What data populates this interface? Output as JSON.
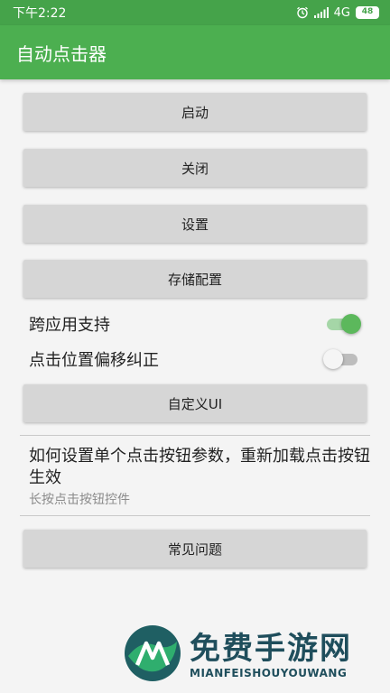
{
  "status_bar": {
    "time": "下午2:22",
    "network": "4G",
    "battery": "48",
    "icons": [
      "alarm-icon",
      "signal-icon"
    ]
  },
  "app_bar": {
    "title": "自动点击器"
  },
  "buttons": {
    "start": "启动",
    "close": "关闭",
    "settings": "设置",
    "save_config": "存储配置",
    "custom_ui": "自定义UI",
    "faq": "常见问题"
  },
  "switches": {
    "cross_app": {
      "label": "跨应用支持",
      "checked": true
    },
    "offset_correction": {
      "label": "点击位置偏移纠正",
      "checked": false
    }
  },
  "info": {
    "title": "如何设置单个点击按钮参数，重新加载点击按钮生效",
    "subtitle": "长按点击按钮控件"
  },
  "watermark": {
    "text": "免费手游网",
    "subtext": "MIANFEISHOUYOUWANG"
  },
  "colors": {
    "status_bar": "#45a34a",
    "app_bar": "#4caf50",
    "switch_on": "#5cb85c",
    "button_bg": "#d6d6d6"
  }
}
